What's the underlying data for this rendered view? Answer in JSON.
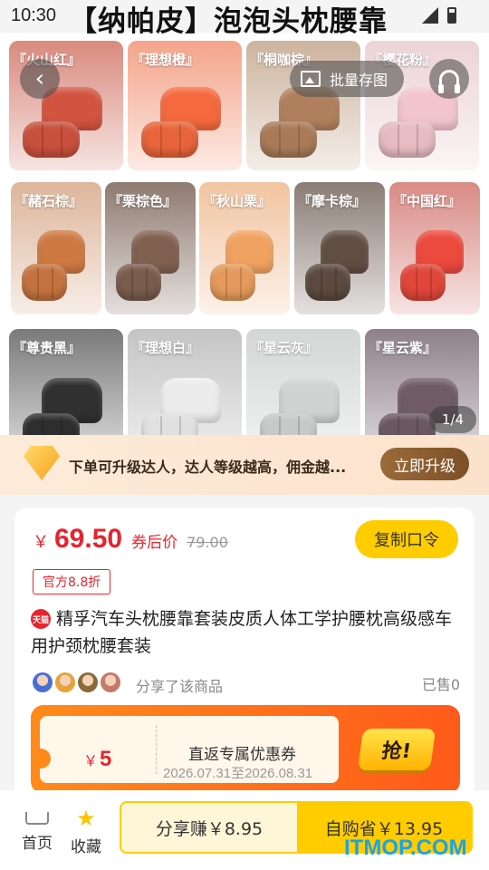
{
  "status": {
    "time": "10:30"
  },
  "title": "【纳帕皮】泡泡头枕腰靠",
  "gallery": {
    "save_label": "批量存图",
    "page_indicator": "1/4",
    "tiles": [
      {
        "label": "『火山红』",
        "color": "#c8503d",
        "bg": "#d98a7e"
      },
      {
        "label": "『理想橙』",
        "color": "#e8643a",
        "bg": "#f4a48a"
      },
      {
        "label": "『桐咖棕』",
        "color": "#a87a58",
        "bg": "#cdb39e"
      },
      {
        "label": "『樱花粉』",
        "color": "#e6bcc2",
        "bg": "#ecd3d6"
      },
      {
        "label": "『赭石棕』",
        "color": "#c4733f",
        "bg": "#ddb59a"
      },
      {
        "label": "『栗棕色』",
        "color": "#7a5c4c",
        "bg": "#8e7a70"
      },
      {
        "label": "『秋山栗』",
        "color": "#e59a5c",
        "bg": "#f2c4a0"
      },
      {
        "label": "『摩卡棕』",
        "color": "#5c4a40",
        "bg": "#8a7c74"
      },
      {
        "label": "『中国红』",
        "color": "#e0463a",
        "bg": "#d98a84"
      },
      {
        "label": "『尊贵黑』",
        "color": "#2e2e2e",
        "bg": "#7a7a7a"
      },
      {
        "label": "『理想白』",
        "color": "#e0e0e0",
        "bg": "#c4c4c4"
      },
      {
        "label": "『星云灰』",
        "color": "#c6c9c8",
        "bg": "#d2d6d5"
      },
      {
        "label": "『星云紫』",
        "color": "#6a5860",
        "bg": "#8e8088"
      }
    ]
  },
  "upgrade": {
    "text": "下单可升级达人，达人等级越高，佣金越...",
    "button": "立即升级"
  },
  "product": {
    "currency": "￥",
    "price": "69.50",
    "after_coupon": "券后价",
    "original_price": "79.00",
    "copy_button": "复制口令",
    "discount_tag": "官方8.8折",
    "tmall_badge": "天猫",
    "title": "精孚汽车头枕腰靠套装皮质人体工学护腰枕高级感车用护颈枕腰套装",
    "share_text": "分享了该商品",
    "sold_text": "已售0",
    "avatar_colors": [
      "#4a6fd1",
      "#e8a23a",
      "#8a6a3a",
      "#c27a6a"
    ]
  },
  "coupon": {
    "currency": "￥",
    "amount": "5",
    "title": "直返专属优惠券",
    "date_range": "2026.07.31至2026.08.31",
    "grab_button": "抢!"
  },
  "bottom_bar": {
    "home": "首页",
    "favorite": "收藏",
    "share_earn": "分享赚￥8.95",
    "self_buy": "自购省￥13.95"
  },
  "watermark": "ITMOP.COM"
}
